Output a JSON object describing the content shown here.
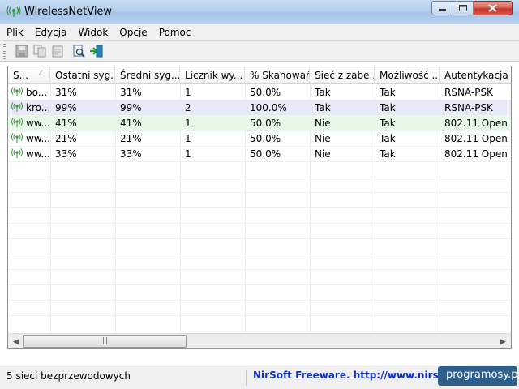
{
  "window": {
    "title": "WirelessNetView"
  },
  "menu": [
    "Plik",
    "Edycja",
    "Widok",
    "Opcje",
    "Pomoc"
  ],
  "toolbar": {
    "icons": [
      "save-icon",
      "copy-icon",
      "properties-icon",
      "refresh-icon",
      "exit-icon"
    ]
  },
  "table": {
    "columns": [
      "S...",
      "Ostatni syg...",
      "Średni syg...",
      "Licznik wy...",
      "% Skanowań",
      "Sieć z zabe...",
      "Możliwość ...",
      "Autentykacja"
    ],
    "rows": [
      [
        "bo...",
        "31%",
        "31%",
        "1",
        "50.0%",
        "Tak",
        "Tak",
        "RSNA-PSK"
      ],
      [
        "kro...",
        "99%",
        "99%",
        "2",
        "100.0%",
        "Tak",
        "Tak",
        "RSNA-PSK"
      ],
      [
        "ww...",
        "41%",
        "41%",
        "1",
        "50.0%",
        "Nie",
        "Tak",
        "802.11 Open"
      ],
      [
        "ww...",
        "21%",
        "21%",
        "1",
        "50.0%",
        "Nie",
        "Tak",
        "802.11 Open"
      ],
      [
        "ww...",
        "33%",
        "33%",
        "1",
        "50.0%",
        "Nie",
        "Tak",
        "802.11 Open"
      ]
    ]
  },
  "status": {
    "count": "5 sieci bezprzewodowych",
    "credit": "NirSoft Freeware.  http://www.nirsoft.net"
  },
  "watermark": "programosy.pl",
  "colors": {
    "selected_row": "#e8e8f8",
    "highlight_row": "#e8f8e8",
    "credit_text": "#1030c0"
  }
}
